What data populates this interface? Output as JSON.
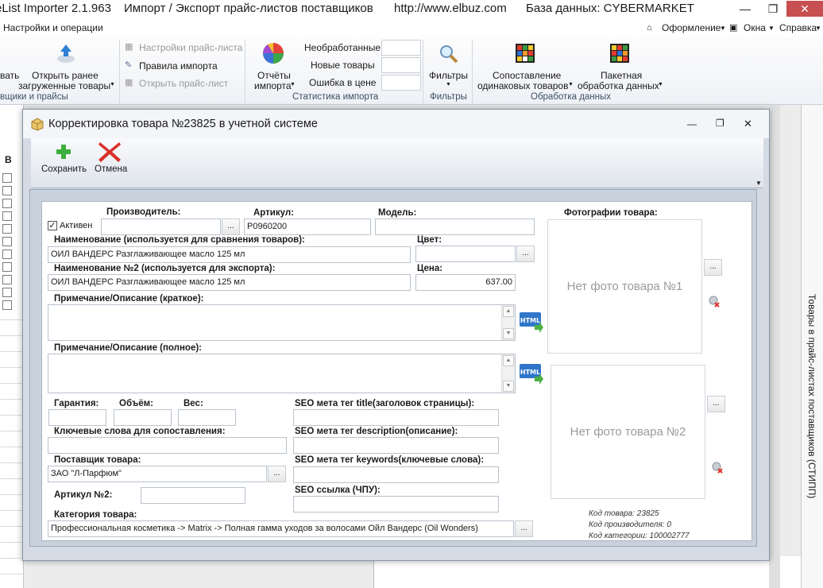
{
  "app": {
    "title_name": "eList Importer 2.1.963",
    "title_desc": "Импорт / Экспорт прайс-листов поставщиков",
    "title_url": "http://www.elbuz.com",
    "title_db": "База данных: CYBERMARKET",
    "win_min": "—",
    "win_max": "❐",
    "win_close": "✕"
  },
  "menu": {
    "settings": "Настройки и операции",
    "design": "Оформление",
    "windows": "Окна",
    "help": "Справка"
  },
  "ribbon": {
    "partial_left": "вать",
    "open_prev_1": "Открыть ранее",
    "open_prev_2": "загруженные товары",
    "pricelist_settings": "Настройки прайс-листа",
    "import_rules": "Правила импорта",
    "open_pricelist": "Открыть прайс-лист",
    "group_left": "вщики и прайсы",
    "reports_1": "Отчёты",
    "reports_2": "импорта",
    "unprocessed": "Необработанные",
    "new_items": "Новые товары",
    "price_error": "Ошибка в цене",
    "group_stats": "Статистика импорта",
    "filters": "Фильтры",
    "group_filters": "Фильтры",
    "match_1": "Сопоставление",
    "match_2": "одинаковых товаров",
    "batch_1": "Пакетная",
    "batch_2": "обработка данных",
    "group_data": "Обработка данных"
  },
  "bg": {
    "col_b": "В",
    "side_panel": "Товары в прайс-листах поставщиков (СТИПП)"
  },
  "dialog": {
    "title": "Корректировка товара №23825 в учетной системе",
    "save": "Сохранить",
    "cancel": "Отмена",
    "active": "Активен",
    "manufacturer_label": "Производитель:",
    "manufacturer_value": "",
    "sku_label": "Артикул:",
    "sku_value": "P0960200",
    "model_label": "Модель:",
    "model_value": "",
    "name_label": "Наименование (используется для сравнения товаров):",
    "name_value": "ОИЛ ВАНДЕРС Разглаживающее масло 125 мл",
    "color_label": "Цвет:",
    "color_value": "",
    "name2_label": "Наименование №2 (используется для экспорта):",
    "name2_value": "ОИЛ ВАНДЕРС Разглаживающее масло 125 мл",
    "price_label": "Цена:",
    "price_value": "637.00",
    "short_desc_label": "Примечание/Описание (краткое):",
    "full_desc_label": "Примечание/Описание (полное):",
    "warranty_label": "Гарантия:",
    "volume_label": "Объём:",
    "weight_label": "Вес:",
    "keywords_label": "Ключевые слова для сопоставления:",
    "supplier_label": "Поставщик товара:",
    "supplier_value": "ЗАО \"Л-Парфюм\"",
    "sku2_label": "Артикул №2:",
    "category_label": "Категория товара:",
    "category_value": "Профессиональная косметика -> Matrix -> Полная гамма уходов за волосами Ойл Вандерс (Oil Wonders)",
    "seo_title_label": "SEO мета тег title(заголовок страницы):",
    "seo_desc_label": "SEO мета тег description(описание):",
    "seo_kw_label": "SEO мета тег keywords(ключевые слова):",
    "seo_url_label": "SEO ссылка (ЧПУ):",
    "photos_label": "Фотографии товара:",
    "photo1": "Нет фото товара №1",
    "photo2": "Нет фото товара №2",
    "dots": "...",
    "html_badge": "HTML",
    "item_code": "Код товара: 23825",
    "maker_code": "Код производителя: 0",
    "category_code": "Код категории: 100002777"
  }
}
